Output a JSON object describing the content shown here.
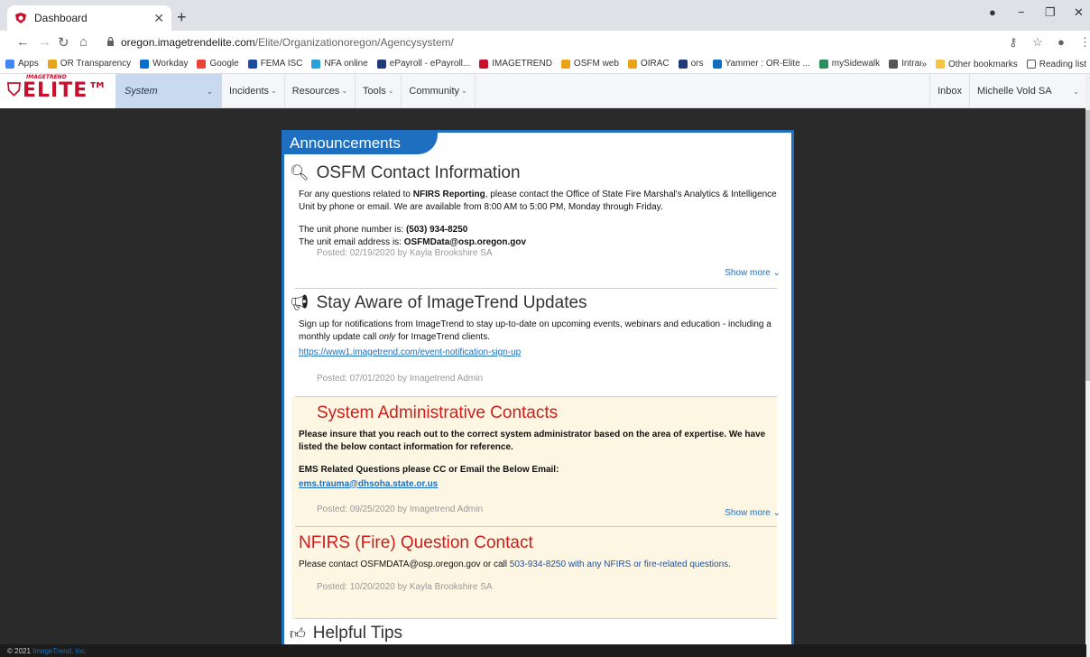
{
  "browser": {
    "tab_title": "Dashboard",
    "url_host": "oregon.imagetrendelite.com",
    "url_path": "/Elite/Organizationoregon/Agencysystem/",
    "bookmarks": [
      {
        "label": "Apps",
        "color": "#4285f4"
      },
      {
        "label": "OR Transparency",
        "color": "#e8a317"
      },
      {
        "label": "Workday",
        "color": "#0a6ed1"
      },
      {
        "label": "Google",
        "color": "#ea4335"
      },
      {
        "label": "FEMA ISC",
        "color": "#1a4fa0"
      },
      {
        "label": "NFA online",
        "color": "#2b9fd9"
      },
      {
        "label": "ePayroll - ePayroll...",
        "color": "#203a7a"
      },
      {
        "label": "IMAGETREND",
        "color": "#c8102e"
      },
      {
        "label": "OSFM web",
        "color": "#e8a317"
      },
      {
        "label": "OIRAC",
        "color": "#e8a317"
      },
      {
        "label": "ors",
        "color": "#203a7a"
      },
      {
        "label": "Yammer : OR-Elite ...",
        "color": "#106ebe"
      },
      {
        "label": "mySidewalk",
        "color": "#2b8c5c"
      },
      {
        "label": "Intranet",
        "color": "#555555"
      }
    ],
    "more_bookmarks": "»",
    "other_bookmarks": "Other bookmarks",
    "reading_list": "Reading list"
  },
  "app": {
    "logo_text": "ELITE",
    "logo_sup": "IMAGETREND",
    "system_label": "System",
    "nav": [
      "Incidents",
      "Resources",
      "Tools",
      "Community"
    ],
    "inbox": "Inbox",
    "user": "Michelle Vold SA"
  },
  "panel": {
    "title": "Announcements"
  },
  "announcements": {
    "a1": {
      "title": "OSFM Contact Information",
      "p1_a": "For any questions related to ",
      "p1_b": "NFIRS Reporting",
      "p1_c": ", please contact the Office of State Fire Marshal's Analytics & Intelligence Unit by phone or email. We are available from 8:00 AM to 5:00 PM, Monday through Friday.",
      "phone_label": "The unit phone number is: ",
      "phone": "(503) 934-8250",
      "email_label": "The unit email address is: ",
      "email": "OSFMData@osp.oregon.gov",
      "posted": "Posted: 02/19/2020 by Kayla Brookshire SA",
      "show_more": "Show more"
    },
    "a2": {
      "title": "Stay Aware of ImageTrend Updates",
      "p1_a": "Sign up for notifications from ImageTrend to stay up-to-date on upcoming events, webinars and education - including a monthly update call ",
      "p1_b": "only",
      "p1_c": " for ImageTrend clients.",
      "link": "https://www1.imagetrend.com/event-notification-sign-up",
      "posted": "Posted: 07/01/2020 by Imagetrend Admin"
    },
    "a3": {
      "title": "System Administrative Contacts",
      "p1": "Please insure that you reach out to the correct system administrator based on the area of expertise. We have listed the below contact information for reference.",
      "p2": "EMS Related Questions please CC or Email the Below Email:",
      "email": "ems.trauma@dhsoha.state.or.us",
      "posted": "Posted: 09/25/2020 by Imagetrend Admin",
      "show_more": "Show more"
    },
    "a4": {
      "title": "NFIRS (Fire) Question Contact",
      "p1_a": "Please contact OSFMDATA@osp.oregon.gov or call ",
      "p1_b": "503-934-8250 with any NFIRS or fire-related questions.",
      "posted": "Posted: 10/20/2020 by Kayla Brookshire SA"
    },
    "a5": {
      "title": "Helpful Tips"
    }
  },
  "footer": {
    "copyright": "© 2021 ",
    "company": "ImageTrend, Inc."
  }
}
